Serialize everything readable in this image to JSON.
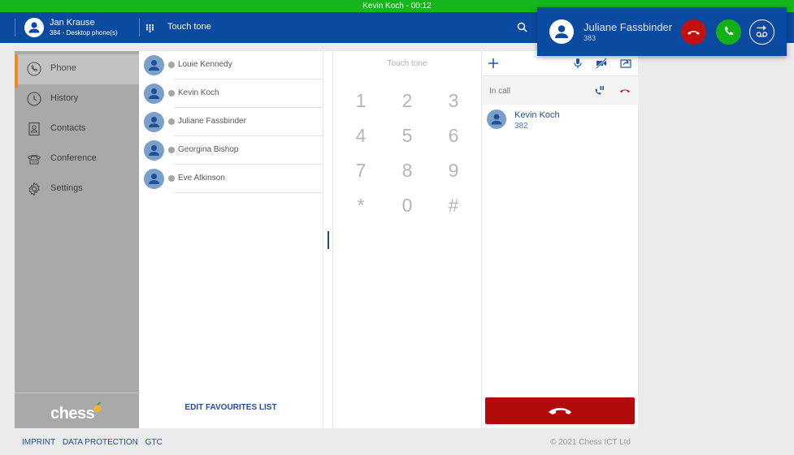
{
  "status_bar": {
    "text": "Kevin Koch - 00:12",
    "color": "#15b51c"
  },
  "header": {
    "user_name": "Jan Krause",
    "user_sub": "384 - Desktop phone(s)",
    "title": "Touch tone",
    "color": "#0a4aa0"
  },
  "sidebar": {
    "items": [
      {
        "label": "Phone",
        "icon": "phone-icon",
        "active": true
      },
      {
        "label": "History",
        "icon": "clock-icon",
        "active": false
      },
      {
        "label": "Contacts",
        "icon": "contact-card-icon",
        "active": false
      },
      {
        "label": "Conference",
        "icon": "conference-phone-icon",
        "active": false
      },
      {
        "label": "Settings",
        "icon": "gear-icon",
        "active": false
      }
    ],
    "logo_text": "chess",
    "accent": "#f08a24"
  },
  "favourites": {
    "items": [
      {
        "name": "Louie Kennedy"
      },
      {
        "name": "Kevin Koch"
      },
      {
        "name": "Juliane Fassbinder"
      },
      {
        "name": "Georgina Bishop"
      },
      {
        "name": "Eve Atkinson"
      }
    ],
    "edit_label": "EDIT FAVOURITES LIST"
  },
  "keypad": {
    "title": "Touch tone",
    "keys": [
      "1",
      "2",
      "3",
      "4",
      "5",
      "6",
      "7",
      "8",
      "9",
      "*",
      "0",
      "#"
    ]
  },
  "call_panel": {
    "in_call_label": "In call",
    "entry": {
      "name": "Kevin Koch",
      "number": "382"
    },
    "hangup_color": "#b20b0b"
  },
  "footer": {
    "links": [
      "IMPRINT",
      "DATA PROTECTION",
      "GTC"
    ],
    "copyright": "© 2021 Chess ICT Ltd"
  },
  "incoming_call": {
    "name": "Juliane Fassbinder",
    "number": "383",
    "reject_color": "#c21010",
    "accept_color": "#13b018"
  }
}
